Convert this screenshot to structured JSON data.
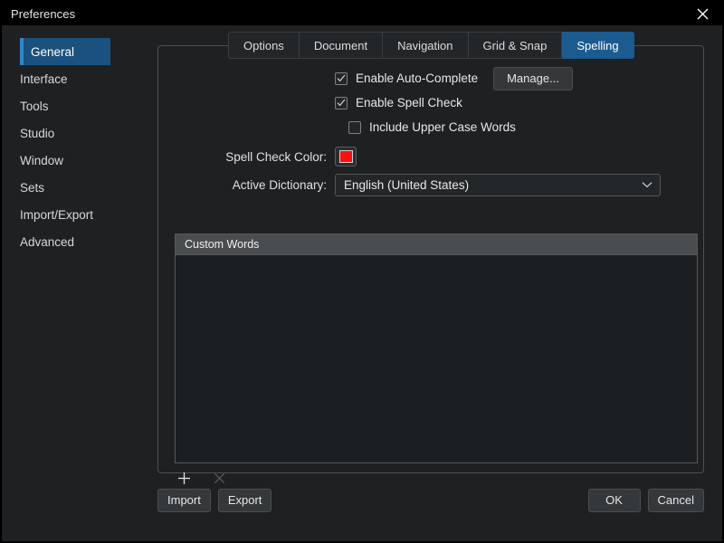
{
  "window": {
    "title": "Preferences",
    "close_icon": "close-icon"
  },
  "sidebar": {
    "items": [
      {
        "label": "General",
        "selected": true
      },
      {
        "label": "Interface",
        "selected": false
      },
      {
        "label": "Tools",
        "selected": false
      },
      {
        "label": "Studio",
        "selected": false
      },
      {
        "label": "Window",
        "selected": false
      },
      {
        "label": "Sets",
        "selected": false
      },
      {
        "label": "Import/Export",
        "selected": false
      },
      {
        "label": "Advanced",
        "selected": false
      }
    ]
  },
  "tabs": [
    {
      "label": "Options",
      "active": false
    },
    {
      "label": "Document",
      "active": false
    },
    {
      "label": "Navigation",
      "active": false
    },
    {
      "label": "Grid & Snap",
      "active": false
    },
    {
      "label": "Spelling",
      "active": true
    }
  ],
  "spelling": {
    "auto_complete": {
      "label": "Enable Auto-Complete",
      "checked": true
    },
    "manage_button": "Manage...",
    "spell_check": {
      "label": "Enable Spell Check",
      "checked": true
    },
    "upper_case": {
      "label": "Include Upper Case Words",
      "checked": false
    },
    "spell_check_color": {
      "label": "Spell Check Color:",
      "value": "#ff0f0f"
    },
    "active_dictionary": {
      "label": "Active Dictionary:",
      "value": "English (United States)",
      "chevron_icon": "chevron-down-icon"
    },
    "custom_words": {
      "header": "Custom Words",
      "rows": [],
      "add_icon": "plus-icon",
      "remove_icon": "close-icon"
    }
  },
  "footer": {
    "import": "Import",
    "export": "Export",
    "ok": "OK",
    "cancel": "Cancel"
  },
  "colors": {
    "accent_blue": "#1c5b8f",
    "sidebar_selected": "#1b517f",
    "sidebar_accent_bar": "#2d87c8",
    "window_bg": "#1e2022",
    "titlebar_bg": "#000000",
    "list_header_bg": "#4a4d50"
  }
}
